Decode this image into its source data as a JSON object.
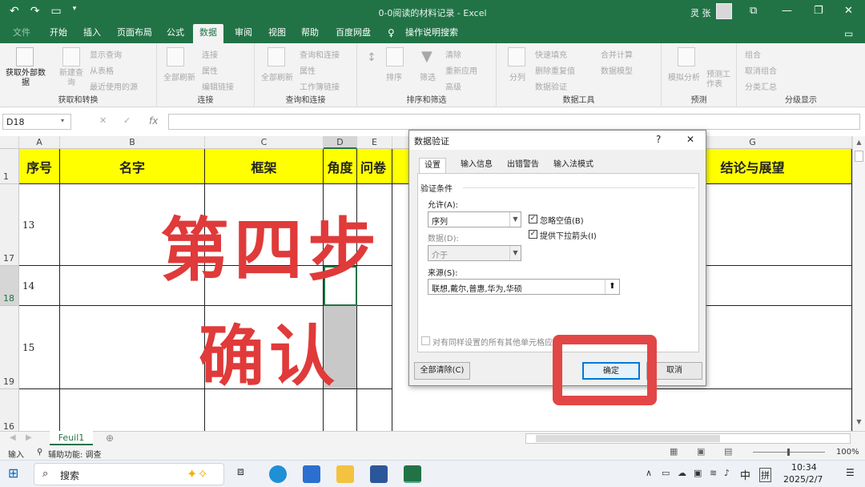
{
  "window": {
    "doc_title": "0-0阅读的材料记录 - Excel",
    "user_name": "灵 张"
  },
  "tabs": [
    "文件",
    "开始",
    "插入",
    "页面布局",
    "公式",
    "数据",
    "审阅",
    "视图",
    "帮助",
    "百度网盘",
    "操作说明搜索"
  ],
  "active_tab": "数据",
  "ribbon": {
    "get_data": "获取外部数据",
    "new_query": "新建查询",
    "show_queries": "显示查询",
    "from_table": "从表格",
    "recent_sources": "最近使用的源",
    "group1": "获取和转换",
    "refresh_all": "全部刷新",
    "connections": "连接",
    "properties": "属性",
    "edit_links": "编辑链接",
    "group2": "连接",
    "refresh_all2": "全部刷新",
    "queries_connections": "查询和连接",
    "properties2": "属性",
    "workbook_links": "工作簿链接",
    "group3": "查询和连接",
    "sort": "排序",
    "filter": "筛选",
    "clear": "清除",
    "reapply": "重新应用",
    "advanced": "高级",
    "group4": "排序和筛选",
    "text_to_columns": "分列",
    "flash_fill": "快速填充",
    "remove_duplicates": "删除重复值",
    "data_validation": "数据验证",
    "consolidate": "合并计算",
    "data_model": "数据模型",
    "group5": "数据工具",
    "what_if": "模拟分析",
    "forecast_sheet": "预测工作表",
    "group6": "预测",
    "group_outline": "组合",
    "ungroup": "取消组合",
    "subtotal": "分类汇总",
    "group7": "分级显示"
  },
  "formula_bar": {
    "name_box": "D18",
    "fx": "fx"
  },
  "grid": {
    "columns": [
      "A",
      "B",
      "C",
      "D",
      "E",
      "G"
    ],
    "header_row_num": "1",
    "headers": [
      "序号",
      "名字",
      "框架",
      "角度",
      "问卷",
      "结论与展望"
    ],
    "row_numbers": [
      "17",
      "18",
      "19",
      "16"
    ],
    "cell_values": [
      "13",
      "14",
      "15"
    ]
  },
  "overlay": {
    "line1": "第四步",
    "line2": "确认"
  },
  "dialog": {
    "title": "数据验证",
    "help": "?",
    "close": "✕",
    "tabs": [
      "设置",
      "输入信息",
      "出错警告",
      "输入法模式"
    ],
    "section": "验证条件",
    "allow_label": "允许(A):",
    "allow_value": "序列",
    "ignore_blank": "忽略空值(B)",
    "dropdown": "提供下拉箭头(I)",
    "data_label": "数据(D):",
    "data_value": "介于",
    "source_label": "来源(S):",
    "source_value": "联想,戴尔,普惠,华为,华硕",
    "apply_all": "对有同样设置的所有其他单元格应用",
    "clear_all": "全部清除(C)",
    "ok": "确定",
    "cancel": "取消"
  },
  "sheet": {
    "tab": "Feuil1"
  },
  "status": {
    "mode": "输入",
    "accessibility": "辅助功能: 调查",
    "zoom": "100%"
  },
  "taskbar": {
    "search": "搜索",
    "ime": "中",
    "ime2": "拼",
    "time": "10:34",
    "date": "2025/2/7"
  },
  "colors": {
    "excel_green": "#217346",
    "header_yellow": "#ffff00",
    "annotation_red": "#e03a3a"
  }
}
